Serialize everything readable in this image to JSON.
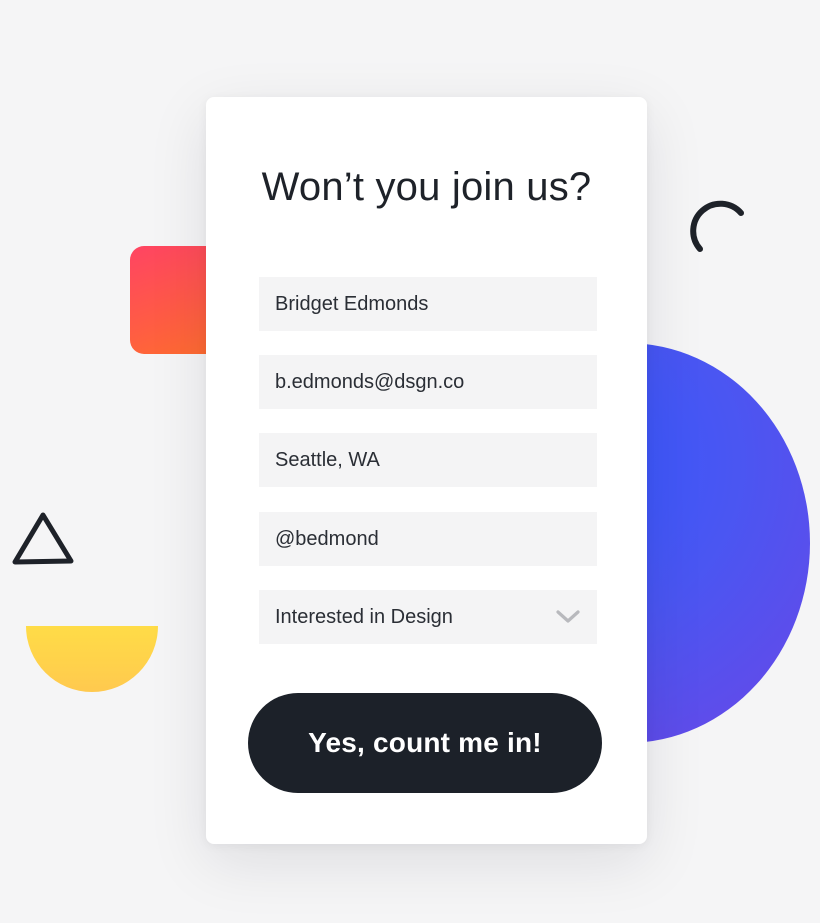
{
  "form": {
    "title": "Won’t you join us?",
    "fields": {
      "name": {
        "value": "Bridget Edmonds"
      },
      "email": {
        "value": "b.edmonds@dsgn.co"
      },
      "location": {
        "value": "Seattle, WA"
      },
      "handle": {
        "value": "@bedmond"
      }
    },
    "interest_select": {
      "selected": "Interested in Design",
      "icon": "chevron-down-icon"
    },
    "submit_label": "Yes, count me in!"
  },
  "decorations": {
    "colors": {
      "orange_square": "#ff5247",
      "blue_circle": "#4a56f2",
      "yellow_half_circle": "#ffd64a",
      "outline_shapes": "#1e2229"
    },
    "icons": [
      "triangle-outline-shape",
      "arc-outline-shape"
    ]
  }
}
